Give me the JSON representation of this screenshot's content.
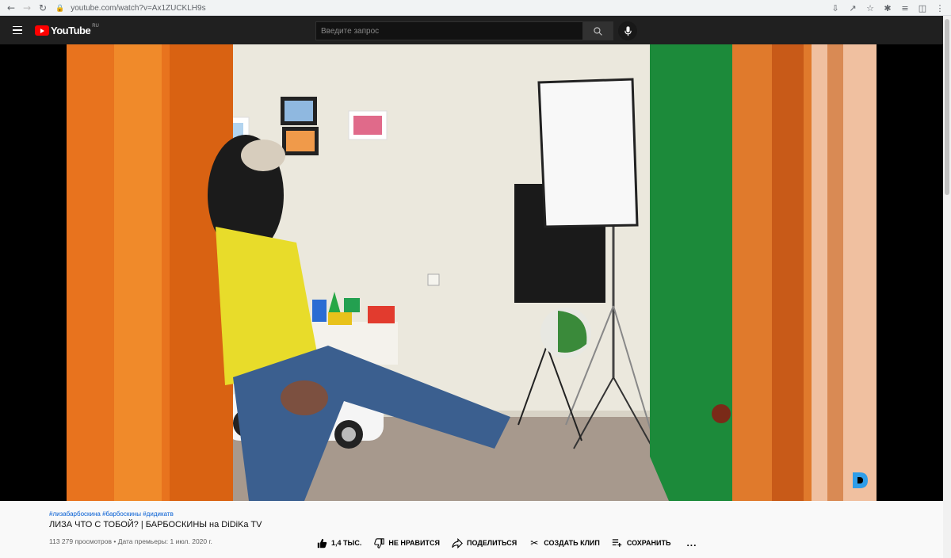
{
  "browser": {
    "url": "youtube.com/watch?v=Ax1ZUCKLH9s"
  },
  "header": {
    "logo_text": "YouTube",
    "logo_region": "RU",
    "search_placeholder": "Введите запрос"
  },
  "video": {
    "watermark": "D"
  },
  "info": {
    "hashtags": "#лизабарбоскина #барбоскины #дидикатв",
    "title": "ЛИЗА ЧТО С ТОБОЙ? | БАРБОСКИНЫ на DiDiKa TV",
    "meta": "113 279 просмотров • Дата премьеры: 1 июл. 2020 г.",
    "actions": {
      "like": "1,4 ТЫС.",
      "dislike": "НЕ НРАВИТСЯ",
      "share": "ПОДЕЛИТЬСЯ",
      "clip": "СОЗДАТЬ КЛИП",
      "save": "СОХРАНИТЬ",
      "more": "..."
    }
  },
  "colors": {
    "accent": "#ff0000",
    "header_bg": "#202020",
    "link": "#065fd4"
  }
}
